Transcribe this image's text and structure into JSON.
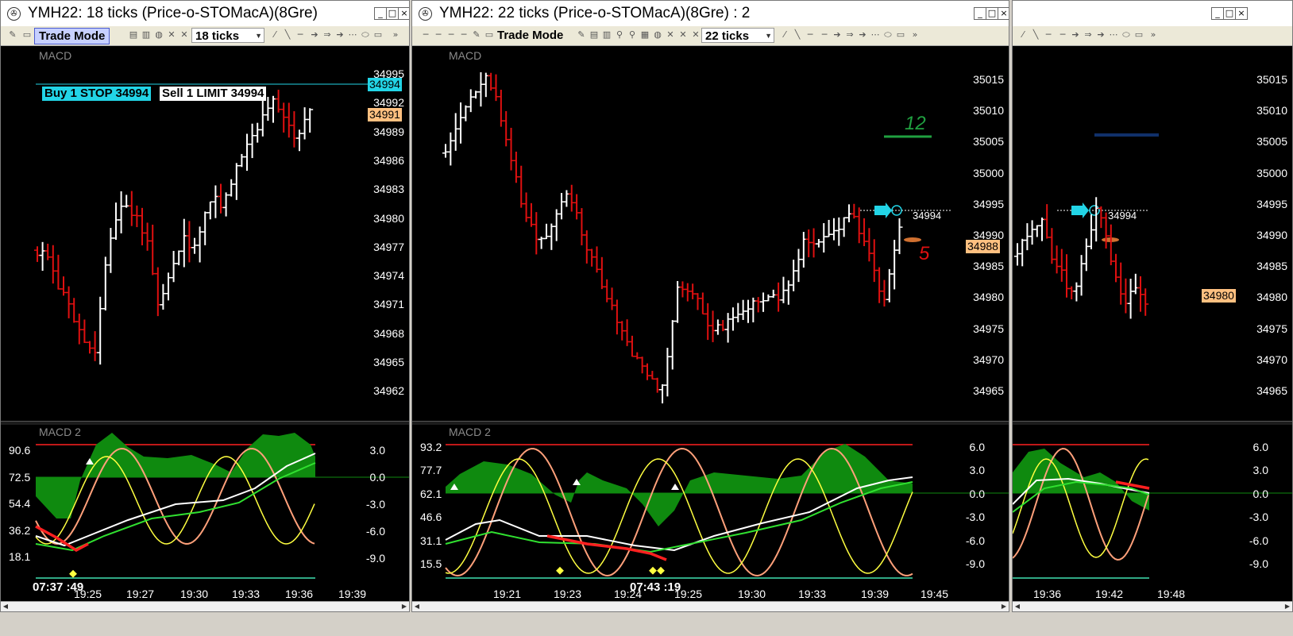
{
  "colors": {
    "up_bar": "#ffffff",
    "down_bar": "#e01010",
    "cloud": "#0f8a0f",
    "overbought": "#ff2020",
    "oversold": "#40e0b0",
    "zero": "#0f8a0f",
    "slow": "#ff2020",
    "orange_osc": "#ffa07a",
    "yellow_osc": "#ffff40",
    "white_ma": "#ffffff",
    "green_ma": "#30e030",
    "buy_order": "#22d4e6",
    "price_tag": "#ffc080"
  },
  "windows": [
    {
      "title": "YMH22: 18 ticks (Price-o-STOMacA)(8Gre)",
      "icon": "chart-app-icon",
      "toolbar": {
        "trade_mode": "Trade Mode",
        "ticks": "18 ticks"
      },
      "price_pane": {
        "label": "MACD",
        "axis": [
          "34995",
          "34992",
          "34989",
          "34986",
          "34983",
          "34980",
          "34977",
          "34974",
          "34971",
          "34968",
          "34965",
          "34962"
        ],
        "last_price": "34994",
        "current_price": "34991",
        "orders": {
          "buy": "Buy 1 STOP 34994",
          "sell": "Sell 1 LIMIT 34994"
        }
      },
      "osc_pane": {
        "label": "MACD 2",
        "left_axis": [
          "90.6",
          "72.5",
          "54.4",
          "36.2",
          "18.1"
        ],
        "right_axis": [
          "3.0",
          "0.0",
          "-3.0",
          "-6.0",
          "-9.0"
        ],
        "times": [
          "19:25",
          "19:27",
          "19:30",
          "19:33",
          "19:36",
          "19:39"
        ],
        "clock": "07:37 :49"
      },
      "window_buttons": [
        "_",
        "□",
        "×"
      ]
    },
    {
      "title": "YMH22: 22 ticks (Price-o-STOMacA)(8Gre) : 2",
      "icon": "chart-app-icon",
      "toolbar": {
        "trade_mode": "Trade Mode",
        "ticks": "22 ticks"
      },
      "price_pane": {
        "label": "MACD",
        "axis": [
          "35015",
          "35010",
          "35005",
          "35000",
          "34995",
          "34990",
          "34985",
          "34980",
          "34975",
          "34970",
          "34965"
        ],
        "current_price": "34988",
        "entry_label": "34994",
        "annot_green": "12",
        "annot_red": "5"
      },
      "osc_pane": {
        "label": "MACD 2",
        "left_axis": [
          "93.2",
          "77.7",
          "62.1",
          "46.6",
          "31.1",
          "15.5"
        ],
        "right_axis": [
          "6.0",
          "3.0",
          "0.0",
          "-3.0",
          "-6.0",
          "-9.0"
        ],
        "times": [
          "19:21",
          "19:23",
          "19:24",
          "19:25",
          "19:30",
          "19:33",
          "19:39",
          "19:45"
        ],
        "clock": "07:43 :19"
      },
      "window_buttons": [
        "_",
        "□",
        "×"
      ]
    },
    {
      "title": "",
      "toolbar": {},
      "price_pane": {
        "axis": [
          "35015",
          "35010",
          "35005",
          "35000",
          "34995",
          "34990",
          "34985",
          "34980",
          "34975",
          "34970",
          "34965"
        ],
        "current_price": "34980",
        "entry_label": "34994"
      },
      "osc_pane": {
        "right_axis": [
          "6.0",
          "3.0",
          "0.0",
          "-3.0",
          "-6.0",
          "-9.0"
        ],
        "times": [
          "19:36",
          "19:42",
          "19:48"
        ]
      },
      "window_buttons": [
        "_",
        "□",
        "×"
      ]
    }
  ]
}
